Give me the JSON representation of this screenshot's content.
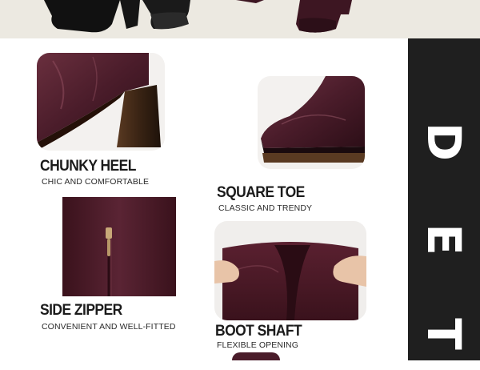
{
  "banner": {
    "letters": [
      "D",
      "E",
      "T"
    ]
  },
  "features": [
    {
      "title": "CHUNKY HEEL",
      "subtitle": "CHIC AND COMFORTABLE"
    },
    {
      "title": "SQUARE TOE",
      "subtitle": "CLASSIC AND TRENDY"
    },
    {
      "title": "SIDE ZIPPER",
      "subtitle": "CONVENIENT AND WELL-FITTED"
    },
    {
      "title": "BOOT SHAFT",
      "subtitle": "FLEXIBLE OPENING"
    }
  ],
  "colors": {
    "leather": "#4a1c2a",
    "banner": "#1f1f1f",
    "top_band": "#ece9e1"
  }
}
